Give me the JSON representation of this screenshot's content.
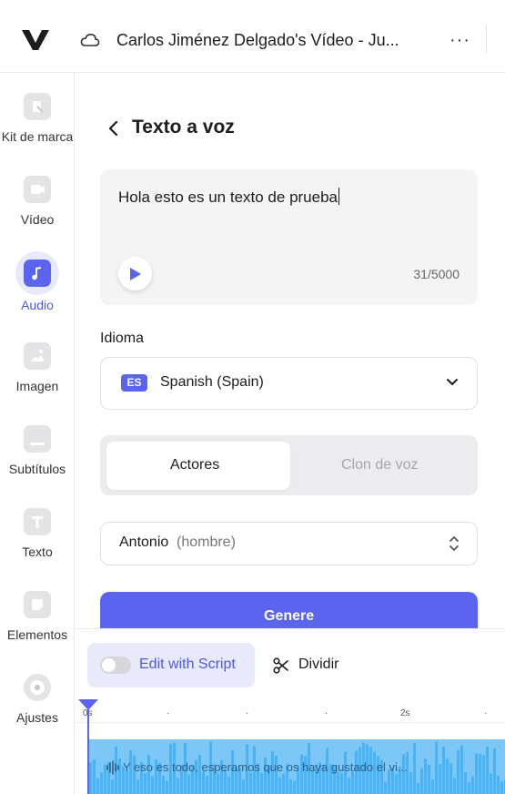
{
  "header": {
    "title": "Carlos Jiménez Delgado's Vídeo - Ju...",
    "more_label": "···"
  },
  "sidebar": {
    "items": [
      {
        "label": "Kit de marca",
        "icon": "brand-kit-icon"
      },
      {
        "label": "Vídeo",
        "icon": "video-icon"
      },
      {
        "label": "Audio",
        "icon": "music-note-icon",
        "active": true
      },
      {
        "label": "Imagen",
        "icon": "image-icon"
      },
      {
        "label": "Subtítulos",
        "icon": "subtitles-icon"
      },
      {
        "label": "Texto",
        "icon": "text-icon"
      },
      {
        "label": "Elementos",
        "icon": "elements-icon"
      },
      {
        "label": "Ajustes",
        "icon": "settings-icon"
      }
    ]
  },
  "panel": {
    "title": "Texto a voz",
    "tts_text": "Hola esto es un texto de prueba",
    "char_count": "31/5000",
    "language_label": "Idioma",
    "language_code": "ES",
    "language_value": "Spanish (Spain)",
    "tabs": [
      {
        "label": "Actores",
        "active": true
      },
      {
        "label": "Clon de voz",
        "active": false
      }
    ],
    "actor_name": "Antonio",
    "actor_gender": "(hombre)",
    "generate_label": "Genere"
  },
  "timeline": {
    "script_toggle_label": "Edit with Script",
    "script_toggle_on": false,
    "split_label": "Dividir",
    "ticks": [
      "0s",
      "2s"
    ],
    "track_text": "Y eso es todo, esperamos que os haya gustado el vi..."
  },
  "colors": {
    "accent": "#5b64ef",
    "track": "#7cc7f5"
  }
}
